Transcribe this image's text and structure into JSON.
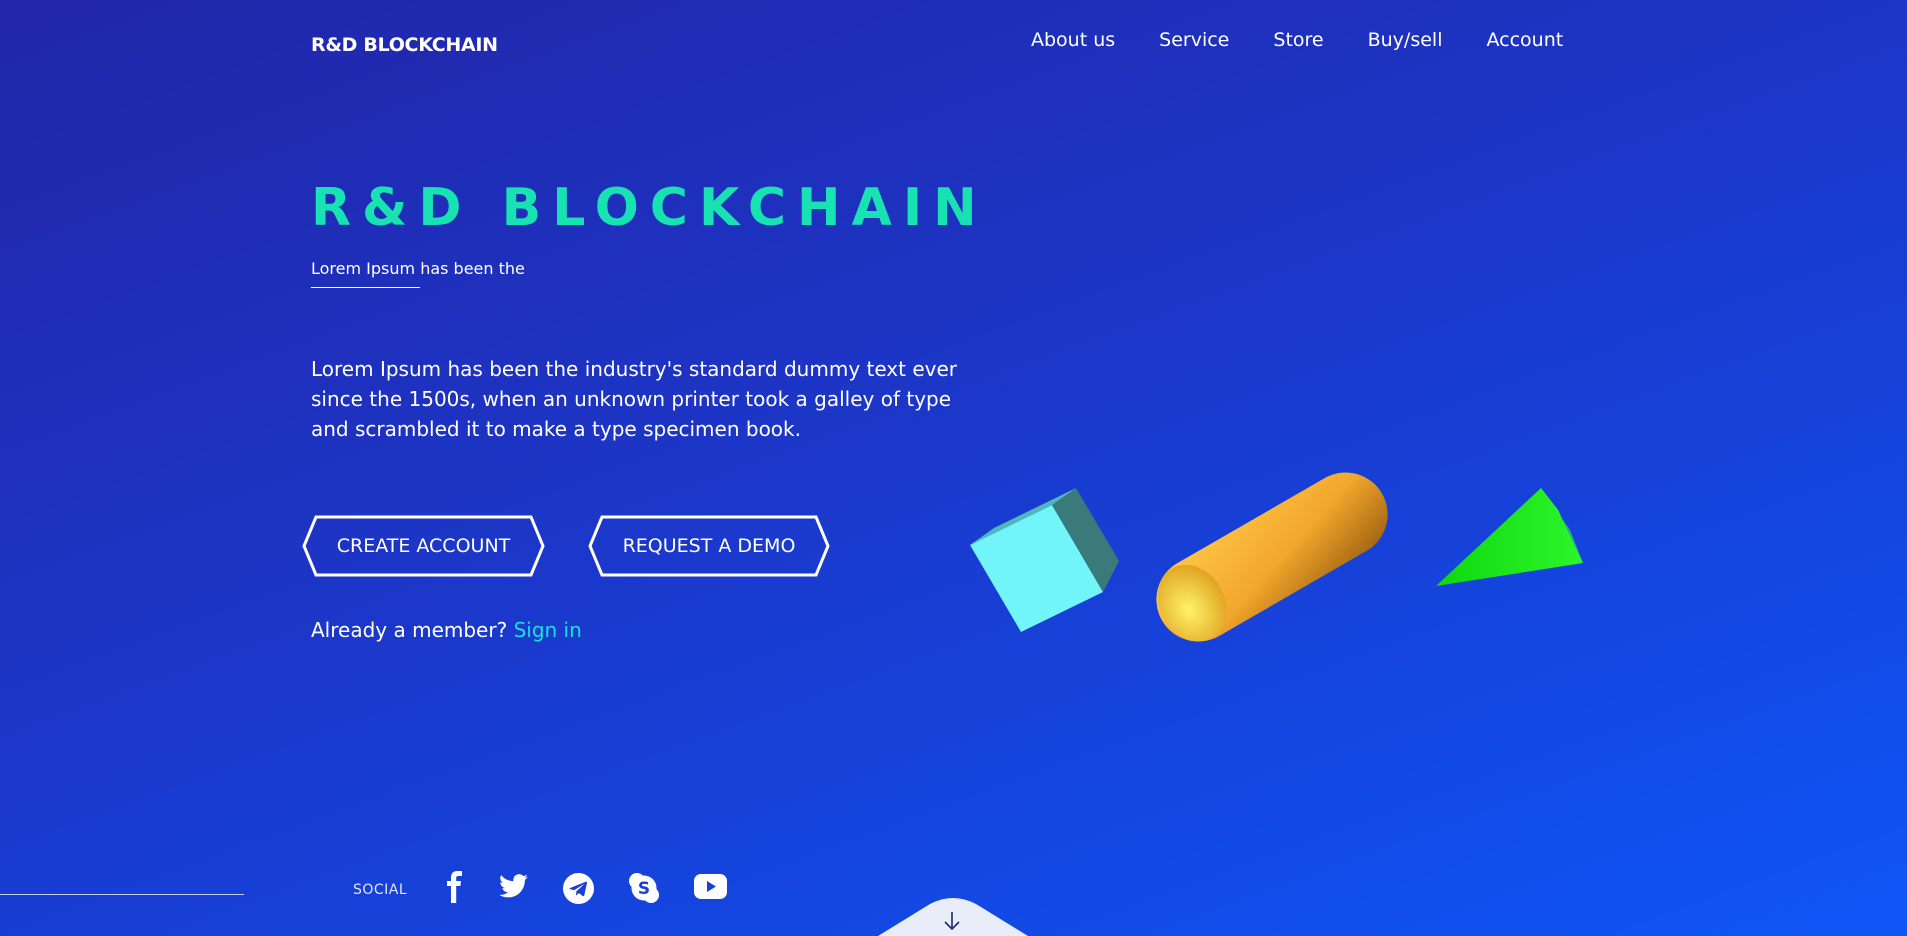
{
  "header": {
    "brand": "R&D BLOCKCHAIN",
    "nav": [
      "About us",
      "Service",
      "Store",
      "Buy/sell",
      "Account"
    ]
  },
  "hero": {
    "title": "R&D BLOCKCHAIN",
    "subtitle": "Lorem Ipsum has been the",
    "description": "Lorem Ipsum has been the industry's standard dummy text ever since the 1500s, when an unknown printer took a galley of type and scrambled it to make a type specimen book.",
    "buttons": {
      "create": "CREATE ACCOUNT",
      "demo": "REQUEST A DEMO"
    },
    "member_text": "Already a member?",
    "signin_link": "Sign in"
  },
  "shapes": {
    "cube_color": "#72f5f8",
    "capsule_color": "#f2a72b",
    "cone_color": "#17ea16"
  },
  "footer": {
    "social_label": "SOCIAL",
    "social_icons": [
      "facebook-icon",
      "twitter-icon",
      "telegram-icon",
      "skype-icon",
      "youtube-icon"
    ],
    "scroll_icon": "arrow-down-icon"
  },
  "colors": {
    "accent": "#18e2b2",
    "link": "#19e0d6",
    "bg_start": "#2126a8",
    "bg_end": "#0f56f7"
  }
}
